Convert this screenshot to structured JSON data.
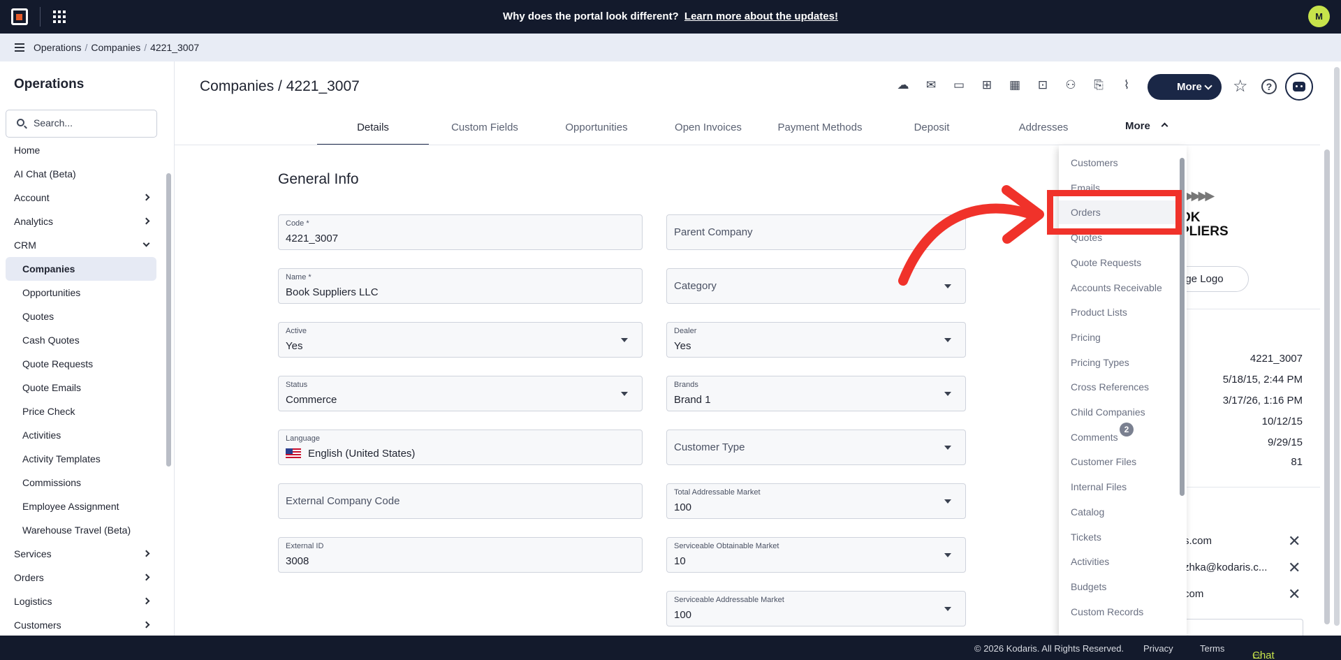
{
  "topbar": {
    "announcement_text": "Why does the portal look different?",
    "announcement_link": "Learn more about the updates!",
    "avatar_initial": "M"
  },
  "breadcrumb": [
    "Operations",
    "Companies",
    "4221_3007"
  ],
  "sidebar": {
    "title": "Operations",
    "search_placeholder": "Search...",
    "items": [
      {
        "label": "Home",
        "level": 0,
        "chevron": "none"
      },
      {
        "label": "AI Chat (Beta)",
        "level": 0,
        "chevron": "none"
      },
      {
        "label": "Account",
        "level": 0,
        "chevron": "right"
      },
      {
        "label": "Analytics",
        "level": 0,
        "chevron": "right"
      },
      {
        "label": "CRM",
        "level": 0,
        "chevron": "down"
      },
      {
        "label": "Companies",
        "level": 1,
        "active": true
      },
      {
        "label": "Opportunities",
        "level": 1
      },
      {
        "label": "Quotes",
        "level": 1
      },
      {
        "label": "Cash Quotes",
        "level": 1
      },
      {
        "label": "Quote Requests",
        "level": 1
      },
      {
        "label": "Quote Emails",
        "level": 1
      },
      {
        "label": "Price Check",
        "level": 1
      },
      {
        "label": "Activities",
        "level": 1
      },
      {
        "label": "Activity Templates",
        "level": 1
      },
      {
        "label": "Commissions",
        "level": 1
      },
      {
        "label": "Employee Assignment",
        "level": 1
      },
      {
        "label": "Warehouse Travel (Beta)",
        "level": 1
      },
      {
        "label": "Services",
        "level": 0,
        "chevron": "right"
      },
      {
        "label": "Orders",
        "level": 0,
        "chevron": "right"
      },
      {
        "label": "Logistics",
        "level": 0,
        "chevron": "right"
      },
      {
        "label": "Customers",
        "level": 0,
        "chevron": "right"
      }
    ]
  },
  "header": {
    "title": "Companies / 4221_3007",
    "more_button": "More",
    "toolbar_icons": [
      "cloud-upload-icon",
      "mail-icon",
      "card-check-icon",
      "gift-card-icon",
      "building-money-icon",
      "presentation-add-icon",
      "person-add-icon",
      "file-add-icon",
      "paperclip-icon"
    ]
  },
  "tabs": {
    "items": [
      "Details",
      "Custom Fields",
      "Opportunities",
      "Open Invoices",
      "Payment Methods",
      "Deposit",
      "Addresses"
    ],
    "active": "Details",
    "more": "More"
  },
  "form": {
    "section_title": "General Info",
    "code_label": "Code *",
    "code_value": "4221_3007",
    "name_label": "Name *",
    "name_value": "Book Suppliers LLC",
    "active_label": "Active",
    "active_value": "Yes",
    "status_label": "Status",
    "status_value": "Commerce",
    "language_label": "Language",
    "language_value": "English (United States)",
    "external_company_code_placeholder": "External Company Code",
    "external_id_label": "External ID",
    "external_id_value": "3008",
    "parent_company_placeholder": "Parent Company",
    "category_placeholder": "Category",
    "dealer_label": "Dealer",
    "dealer_value": "Yes",
    "brands_label": "Brands",
    "brands_value": "Brand 1",
    "customer_type_placeholder": "Customer Type",
    "tam_label": "Total Addressable Market",
    "tam_value": "100",
    "som_label": "Serviceable Obtainable Market",
    "som_value": "10",
    "sam_label": "Serviceable Addressable Market",
    "sam_value": "100"
  },
  "right_panel": {
    "logo_text_line1": "OK",
    "logo_text_line2": "PLIERS",
    "change_logo": "nge Logo",
    "meta_values": [
      "4221_3007",
      "5/18/15, 2:44 PM",
      "3/17/26, 1:16 PM",
      "10/12/15",
      "9/29/15",
      "81"
    ],
    "emails": [
      "s.com",
      "zhka@kodaris.c...",
      "com"
    ]
  },
  "more_menu": {
    "items": [
      "Customers",
      "Emails",
      "Orders",
      "Quotes",
      "Quote Requests",
      "Accounts Receivable",
      "Product Lists",
      "Pricing",
      "Pricing Types",
      "Cross References",
      "Child Companies",
      "Comments",
      "Customer Files",
      "Internal Files",
      "Catalog",
      "Tickets",
      "Activities",
      "Budgets",
      "Custom Records"
    ],
    "highlighted": "Orders",
    "comments_badge": "2"
  },
  "footer": {
    "copyright": "© 2026 Kodaris. All Rights Reserved.",
    "privacy": "Privacy",
    "terms": "Terms",
    "chat": "Chat with us"
  },
  "colors": {
    "topbar_bg": "#131a2c",
    "accent_navy": "#1a2746",
    "avatar_bg": "#c7e34b",
    "annotation_red": "#f0322a"
  }
}
